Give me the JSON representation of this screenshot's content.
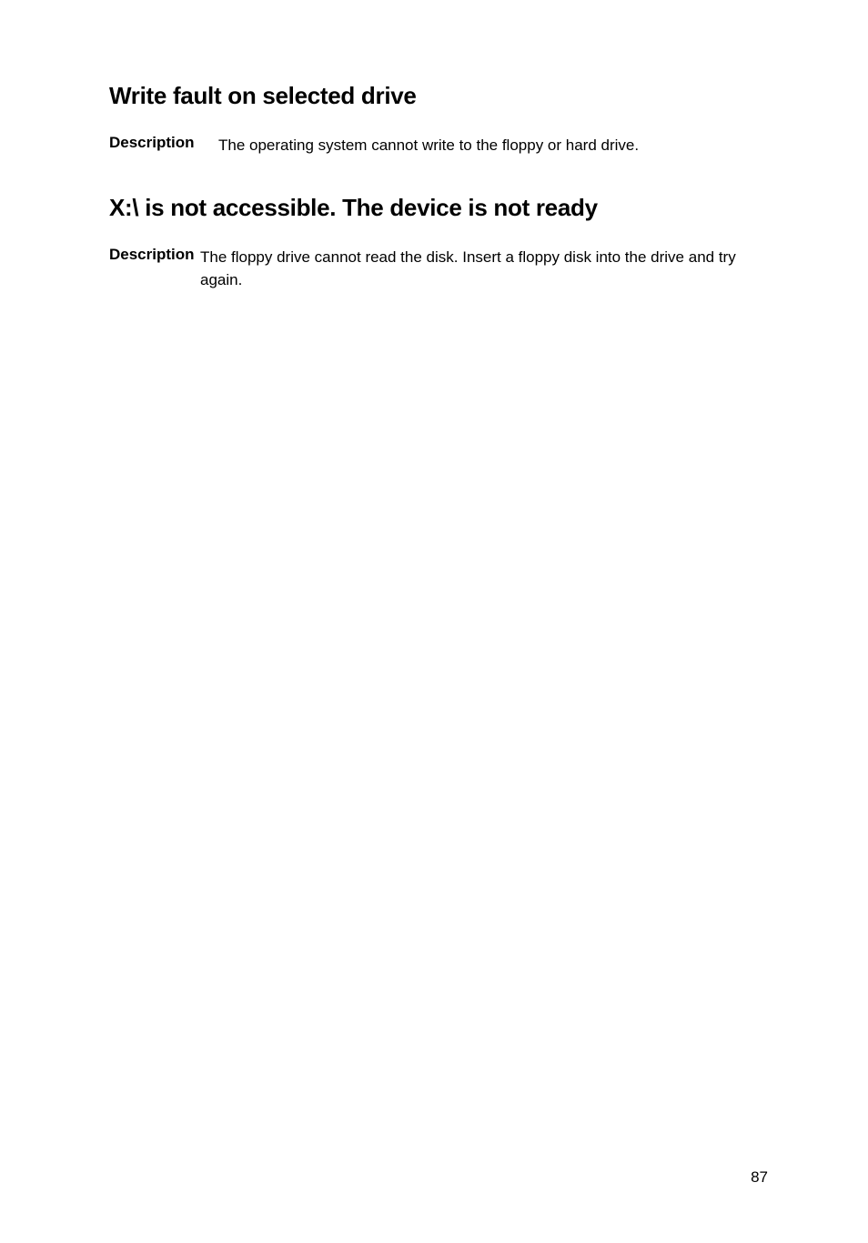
{
  "sections": [
    {
      "heading": "Write fault on selected drive",
      "label": "Description",
      "text": "The operating system cannot write to the floppy or hard drive."
    },
    {
      "heading": "X:\\ is not accessible. The device is not ready",
      "label": "Description",
      "text": "The floppy drive cannot read the disk. Insert a floppy disk into the drive and try again."
    }
  ],
  "page_number": "87"
}
